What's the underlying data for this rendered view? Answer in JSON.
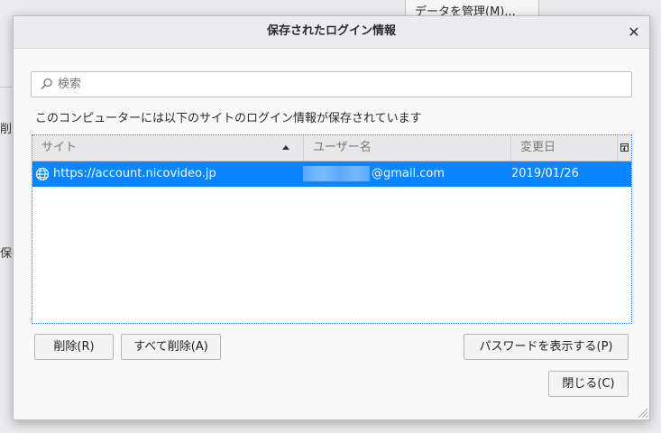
{
  "background": {
    "manage_data_button": "データを管理(M)...",
    "partial_text_1": "削除",
    "partial_text_2": "保"
  },
  "dialog": {
    "title": "保存されたログイン情報",
    "close_icon": "close-icon"
  },
  "search": {
    "placeholder": "検索",
    "icon": "search-icon"
  },
  "description": "このコンピューターには以下のサイトのログイン情報が保存されています",
  "table": {
    "columns": [
      "サイト",
      "ユーザー名",
      "変更日"
    ],
    "sort_column": "サイト",
    "sort_direction": "ascending",
    "rows": [
      {
        "site": "https://account.nicovideo.jp",
        "username_visible": "@gmail.com",
        "date": "2019/01/26",
        "selected": true
      }
    ]
  },
  "buttons": {
    "delete": "削除(R)",
    "delete_all": "すべて削除(A)",
    "show_passwords": "パスワードを表示する(P)",
    "close": "閉じる(C)"
  },
  "colors": {
    "selection": "#0a84ff",
    "focus_border": "#3c78c8"
  }
}
